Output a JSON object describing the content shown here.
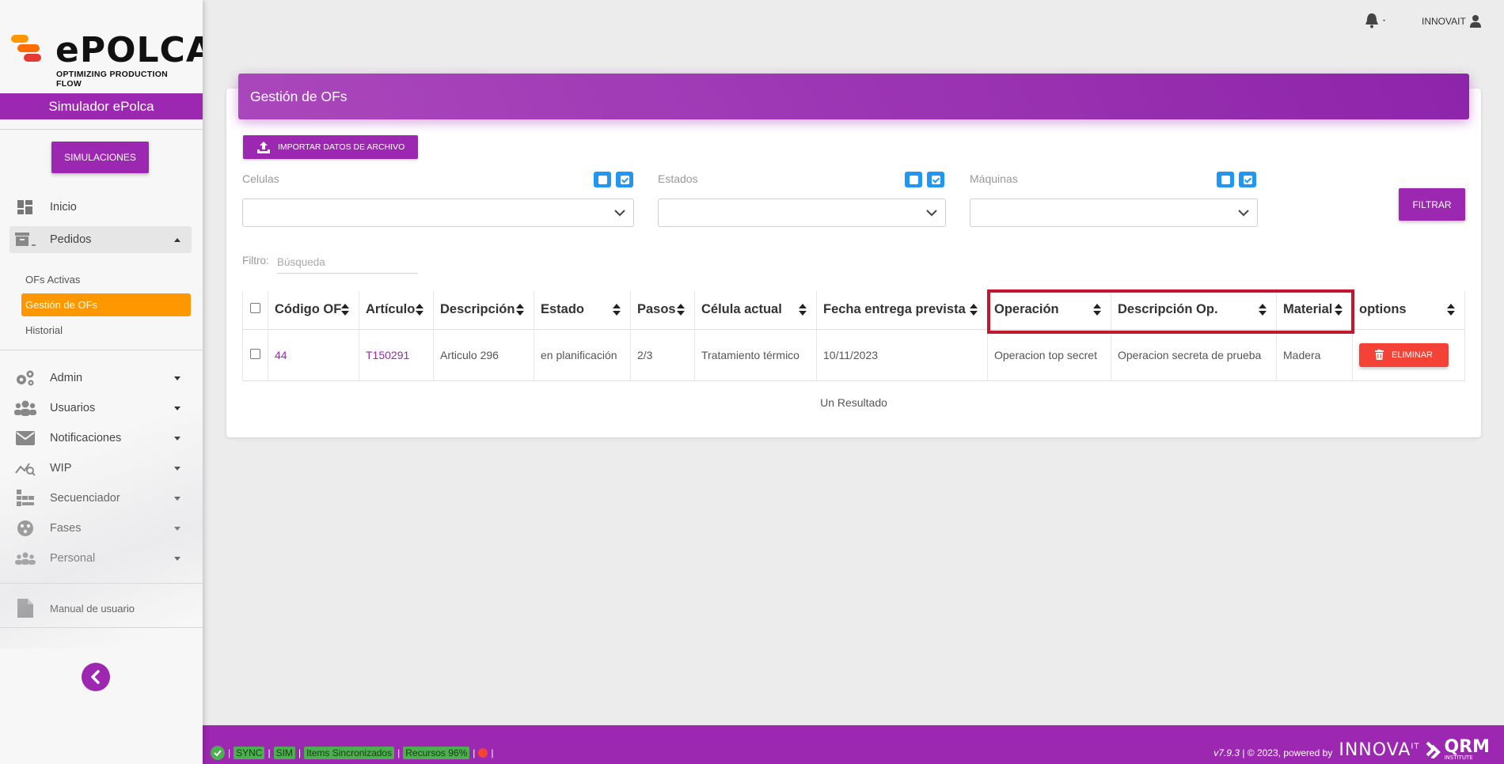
{
  "app": {
    "logo_text": "ePOLCA",
    "logo_tagline": "OPTIMIZING PRODUCTION FLOW",
    "simulator_title": "Simulador ePolca",
    "user_name": "INNOVAIT"
  },
  "sidebar": {
    "simulations_button": "SIMULACIONES",
    "items": [
      {
        "label": "Inicio",
        "icon": "dashboard-icon"
      },
      {
        "label": "Pedidos",
        "icon": "archive-icon",
        "expanded": true
      },
      {
        "label": "Admin",
        "icon": "gears-icon"
      },
      {
        "label": "Usuarios",
        "icon": "users-icon"
      },
      {
        "label": "Notificaciones",
        "icon": "envelope-icon"
      },
      {
        "label": "WIP",
        "icon": "chart-search-icon"
      },
      {
        "label": "Secuenciador",
        "icon": "sequencer-icon"
      },
      {
        "label": "Fases",
        "icon": "phases-icon"
      },
      {
        "label": "Personal",
        "icon": "team-icon"
      }
    ],
    "pedidos_sub": [
      {
        "label": "OFs Activas"
      },
      {
        "label": "Gestión de OFs",
        "active": true
      },
      {
        "label": "Historial"
      }
    ],
    "manual_label": "Manual de usuario"
  },
  "page": {
    "title": "Gestión de OFs",
    "import_button": "IMPORTAR DATOS DE ARCHIVO",
    "filters": {
      "celulas_label": "Celulas",
      "estados_label": "Estados",
      "maquinas_label": "Máquinas",
      "filter_button": "FILTRAR"
    },
    "search": {
      "label": "Filtro:",
      "placeholder": "Búsqueda",
      "value": ""
    },
    "table": {
      "headers": [
        "Código OF",
        "Artículo",
        "Descripción",
        "Estado",
        "Pasos",
        "Célula actual",
        "Fecha entrega prevista",
        "Operación",
        "Descripción Op.",
        "Material",
        "options"
      ],
      "rows": [
        {
          "codigo": "44",
          "articulo": "T150291",
          "descripcion": "Articulo 296",
          "estado": "en planificación",
          "pasos": "2/3",
          "celula": "Tratamiento térmico",
          "fecha": "10/11/2023",
          "operacion": "Operacion top secret",
          "descripcion_op": "Operacion secreta de prueba",
          "material": "Madera",
          "delete_label": "ELIMINAR"
        }
      ]
    },
    "result_text": "Un Resultado"
  },
  "footer": {
    "status_items": [
      "SYNC",
      "SIM",
      "Items Sincronizados",
      "Recursos 96%"
    ],
    "version": "v7.9.3",
    "copyright": "| © 2023, powered by",
    "brand_innova": "INNOVA",
    "brand_innova_sup": "IT",
    "brand_qrm": "QRM",
    "brand_qrm_sub": "INSTITUTE"
  },
  "colors": {
    "primary": "#9c27b0",
    "accent_orange": "#ff9800",
    "danger": "#f44336",
    "info": "#2196f3",
    "success": "#4caf50",
    "highlight_box": "#c2182b"
  }
}
